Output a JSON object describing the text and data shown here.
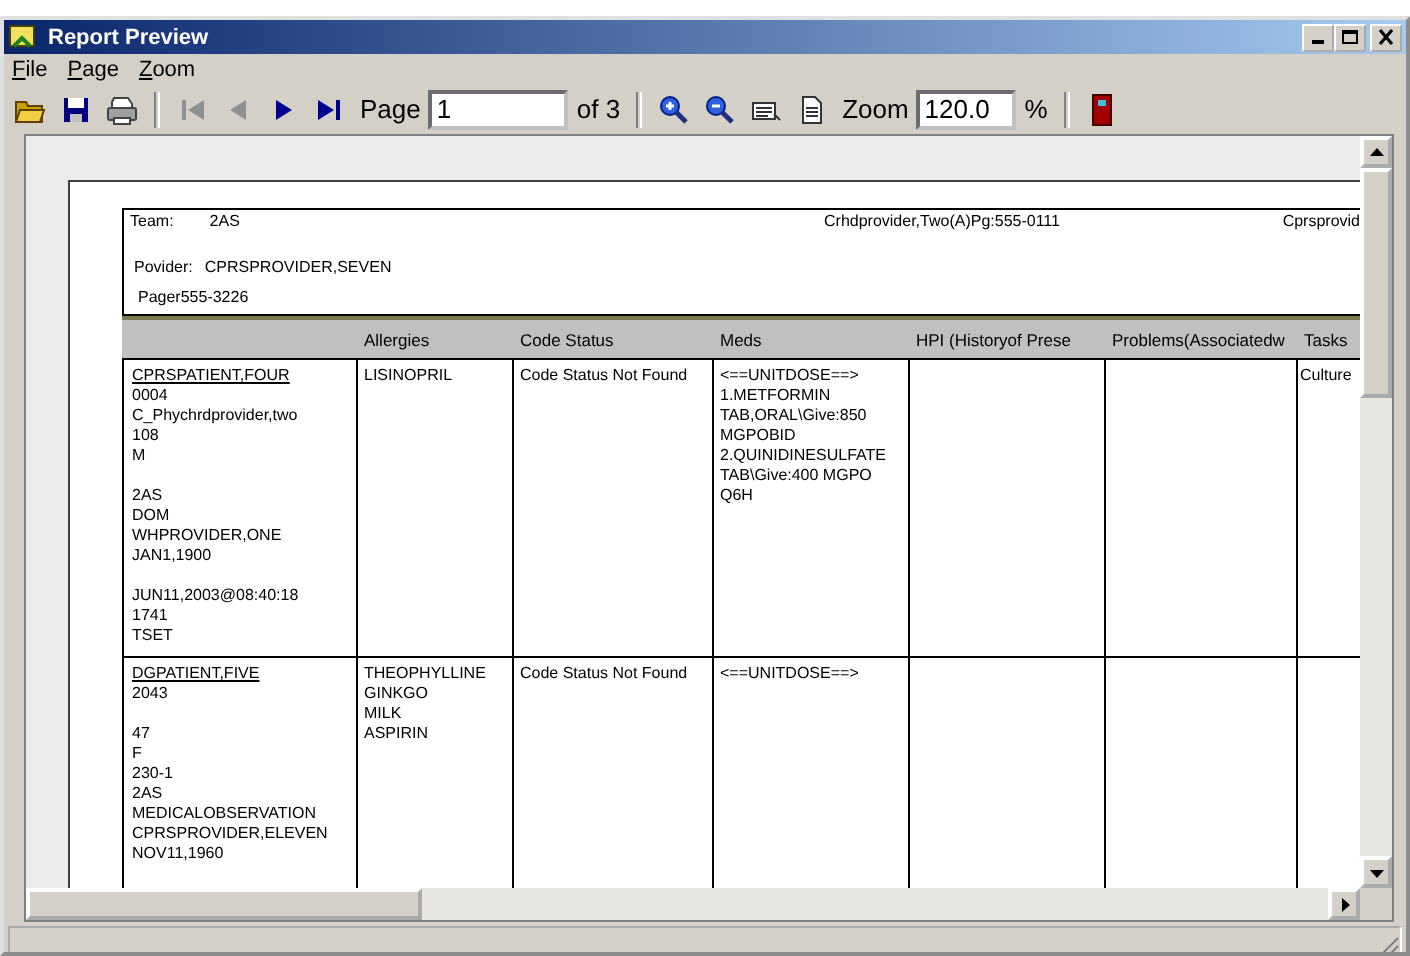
{
  "window": {
    "title": "Report Preview"
  },
  "menu": [
    {
      "label": "File"
    },
    {
      "label": "Page"
    },
    {
      "label": "Zoom"
    }
  ],
  "toolbar": {
    "file_buttons": [
      {
        "kind": "open"
      },
      {
        "kind": "save"
      },
      {
        "kind": "print"
      }
    ],
    "nav_buttons": [
      {
        "kind": "first",
        "disabled": true
      },
      {
        "kind": "prev",
        "disabled": true
      },
      {
        "kind": "next",
        "disabled": false
      },
      {
        "kind": "last",
        "disabled": false
      }
    ],
    "page_label": "Page",
    "page_field": {
      "value": "1"
    },
    "page_total": "of 3",
    "zoom_buttons": [
      {
        "kind": "zoom_in"
      },
      {
        "kind": "zoom_out"
      },
      {
        "kind": "page_width"
      },
      {
        "kind": "whole_page"
      }
    ],
    "zoom_label": "Zoom",
    "zoom_field": {
      "value": "120.0"
    },
    "zoom_unit": "%"
  },
  "report": {
    "header": {
      "team_label": "Team:",
      "team": "2AS",
      "attending": "Crhdprovider,Two(A)Pg:555-0111",
      "column_3": "Cprsprovid",
      "provider_label": "Povider:",
      "provider": "CPRSPROVIDER,SEVEN",
      "pager": "Pager555-3226"
    },
    "table": {
      "columns": [
        "Allergies",
        "Code Status",
        "Meds",
        "HPI (Historyof Prese",
        "Problems(Associatedw",
        "Tasks"
      ],
      "rows": [
        {
          "patient": {
            "name": "CPRSPATIENT,FOUR",
            "line_groups": [
              [
                "0004",
                "C_Phychrdprovider,two",
                "108",
                "M"
              ],
              [
                "2AS",
                "DOM",
                "WHPROVIDER,ONE",
                "JAN1,1900"
              ],
              [
                "JUN11,2003@08:40:18",
                "1741",
                "TSET"
              ]
            ]
          },
          "allergies": [
            "LISINOPRIL"
          ],
          "code_status": "Code Status Not Found",
          "meds": [
            "<==UNITDOSE==>",
            "1.METFORMIN",
            "TAB,ORAL\\Give:850",
            "MGPOBID",
            "2.QUINIDINESULFATE",
            "TAB\\Give:400 MGPO",
            "Q6H"
          ],
          "tasks": "Culture"
        },
        {
          "patient": {
            "name": "DGPATIENT,FIVE",
            "line_groups": [
              [
                "2043"
              ],
              [
                "47",
                "F",
                "230-1",
                "2AS",
                "MEDICALOBSERVATION",
                "CPRSPROVIDER,ELEVEN",
                "NOV11,1960"
              ]
            ]
          },
          "allergies": [
            "THEOPHYLLINE",
            "GINKGO",
            "MILK",
            "ASPIRIN"
          ],
          "code_status": "Code Status Not Found",
          "meds": [
            "<==UNITDOSE==>"
          ]
        }
      ]
    }
  }
}
